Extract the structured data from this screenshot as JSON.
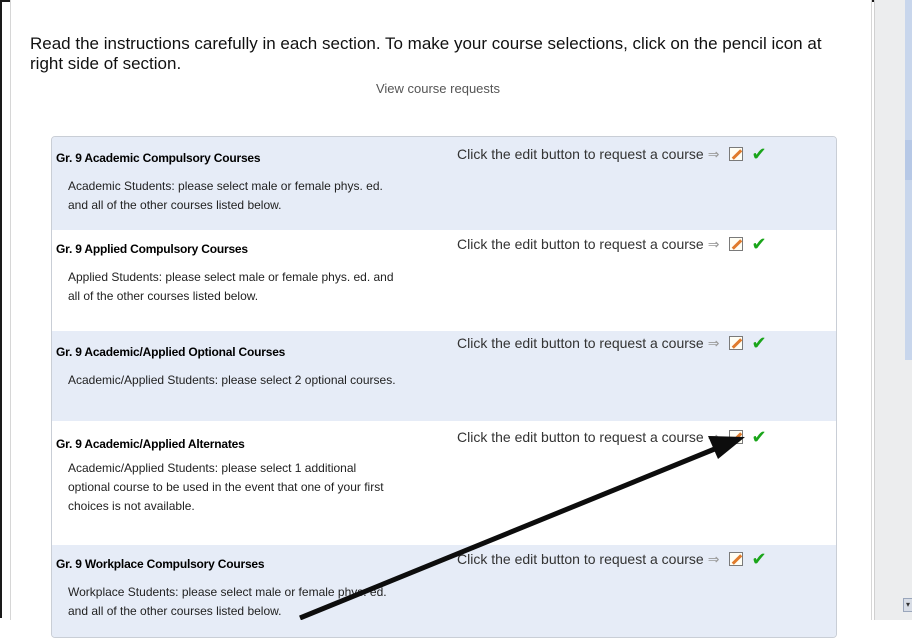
{
  "instructions": "Read the instructions carefully in each section. To make your course selections, click on the pencil icon at right side of section.",
  "view_link": "View course requests",
  "action_text": "Click the edit button to request a course",
  "icons": {
    "arrow": "right-arrow-icon",
    "edit": "pencil-edit-icon",
    "check": "checkmark-icon"
  },
  "colors": {
    "shaded_row": "#e6ecf7",
    "check": "#1aa51a",
    "edit_accent": "#e07b2c"
  },
  "sections": [
    {
      "title": "Gr. 9 Academic Compulsory Courses",
      "description": "Academic Students: please select male or female phys. ed. and all of the other courses listed below."
    },
    {
      "title": "Gr. 9 Applied Compulsory Courses",
      "description": "Applied Students: please select male or female phys. ed. and all of the other courses listed below."
    },
    {
      "title": "Gr. 9 Academic/Applied Optional Courses",
      "description": "Academic/Applied Students: please select 2 optional courses."
    },
    {
      "title": "Gr. 9 Academic/Applied Alternates",
      "description": "Academic/Applied Students: please select 1 additional optional course to be used in the event that one of your first choices is not available."
    },
    {
      "title": "Gr. 9 Workplace Compulsory Courses",
      "description": "Workplace Students: please select male or female phys. ed. and all of the other courses listed below."
    }
  ]
}
